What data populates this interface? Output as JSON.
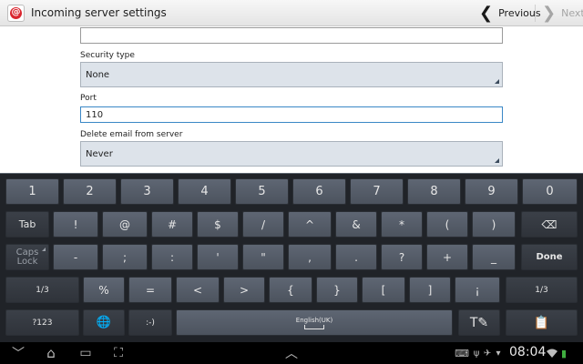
{
  "appbar": {
    "title": "Incoming server settings",
    "app_icon": "email-app-icon",
    "app_icon_glyph": "@",
    "prev_label": "Previous",
    "next_label": "Next",
    "prev_glyph": "❮",
    "next_glyph": "❯"
  },
  "form": {
    "top_field_value": "",
    "security_type_label": "Security type",
    "security_type_value": "None",
    "port_label": "Port",
    "port_value": "110",
    "delete_label": "Delete email from server",
    "delete_value": "Never"
  },
  "keyboard": {
    "row1": [
      "1",
      "2",
      "3",
      "4",
      "5",
      "6",
      "7",
      "8",
      "9",
      "0"
    ],
    "row2": {
      "tab": "Tab",
      "keys": [
        "!",
        "@",
        "#",
        "$",
        "/",
        "^",
        "&",
        "*",
        "(",
        ")"
      ],
      "backspace": "⌫"
    },
    "row3": {
      "caps_line1": "Caps",
      "caps_line2": "Lock",
      "keys": [
        "-",
        ";",
        ":",
        "'",
        "\"",
        ",",
        ".",
        "?",
        "+",
        "_"
      ],
      "done": "Done"
    },
    "row4": {
      "page_left": "1/3",
      "keys": [
        "%",
        "=",
        "<",
        ">",
        "{",
        "}",
        "[",
        "]",
        "¡"
      ],
      "page_right": "1/3"
    },
    "row5": {
      "symbols": "?123",
      "globe": "🌐",
      "smiley": ":-)",
      "space_label": "English(UK)",
      "handwriting": "T✎",
      "clipboard": "📋"
    }
  },
  "sysbar": {
    "time": "08:04",
    "back": "﹀",
    "home": "⌂",
    "recent": "▭",
    "screenshot": "⛶",
    "up": "︿",
    "icons": [
      "⌨",
      "ψ",
      "✈",
      "▾",
      "▮"
    ]
  }
}
